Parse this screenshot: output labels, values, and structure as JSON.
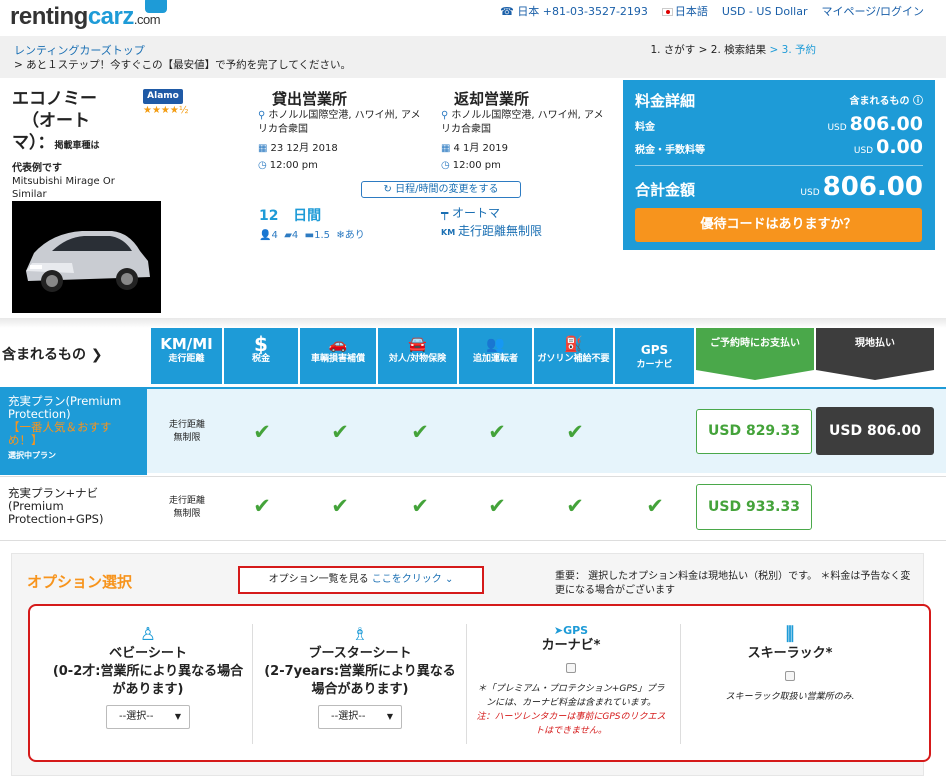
{
  "header": {
    "logo_main": "renting",
    "logo_accent": "carz",
    "logo_suffix": ".com",
    "phone": "日本 +81-03-3527-2193",
    "language": "日本語",
    "currency": "USD - US Dollar",
    "mypage": "マイページ/ログイン"
  },
  "breadcrumb": {
    "top": "レンティングカーズトップ",
    "message": "> あと１ステップ！今すぐこの【最安値】で予約を完了してください。",
    "step1": "1. さがす",
    "step2": "> 2. 検索結果",
    "step3": "> 3. 予約"
  },
  "car": {
    "class_line1": "エコノミー",
    "class_line2": "（オート",
    "class_line3": "マ）：",
    "example_note": "掲載車種は",
    "supplier": "Alamo",
    "stars": "★★★★½",
    "rep_label": "代表例です",
    "model": "Mitsubishi Mirage Or Similar"
  },
  "pickup": {
    "title": "貸出営業所",
    "location": "ホノルル国際空港, ハワイ州, アメリカ合衆国",
    "date": "23 12月 2018",
    "time": "12:00 pm"
  },
  "dropoff": {
    "title": "返却営業所",
    "location": "ホノルル国際空港, ハワイ州, アメリカ合衆国",
    "date": "4 1月 2019",
    "time": "12:00 pm"
  },
  "change_button": "日程/時間の変更をする",
  "rental": {
    "days_num": "12",
    "days_label": "日間",
    "seats": "4",
    "doors": "4",
    "luggage": "1.5",
    "ac": "あり",
    "transmission": "オートマ",
    "mileage": "走行距離無制限"
  },
  "price_panel": {
    "title": "料金詳細",
    "included": "含まれるもの",
    "rate_label": "料金",
    "rate_cur": "USD",
    "rate_value": "806.00",
    "tax_label": "税金・手数料等",
    "tax_cur": "USD",
    "tax_value": "0.00",
    "total_label": "合計金額",
    "total_cur": "USD",
    "total_value": "806.00",
    "promo": "優待コードはありますか？"
  },
  "included_section": {
    "label": "含まれるもの",
    "features": [
      {
        "icon": "KM/MI",
        "label": "走行距離"
      },
      {
        "icon": "$",
        "label": "税金"
      },
      {
        "icon": "🚗",
        "label": "車輌損害補償"
      },
      {
        "icon": "🚘",
        "label": "対人/対物保険"
      },
      {
        "icon": "👥",
        "label": "追加運転者"
      },
      {
        "icon": "⛽",
        "label": "ガソリン補給不要"
      },
      {
        "icon": "GPS",
        "label": "カーナビ"
      }
    ],
    "pay_now": "ご予約時にお支払い",
    "pay_local": "現地払い"
  },
  "plans": [
    {
      "name": "充実プラン(Premium Protection)",
      "highlight": "【一番人気＆おすすめ！】",
      "status": "選択中プラン",
      "mileage1": "走行距離",
      "mileage2": "無制限",
      "price_now": "USD 829.33",
      "price_local": "USD 806.00"
    },
    {
      "name": "充実プラン+ナビ (Premium Protection+GPS)",
      "mileage1": "走行距離",
      "mileage2": "無制限",
      "price_now": "USD 933.33"
    }
  ],
  "options": {
    "title": "オプション選択",
    "list_text": "オプション一覧を見る",
    "list_link": "ここをクリック",
    "notice": "重要： 選択したオプション料金は現地払い（税別）です。 ＊料金は予告なく変更になる場合がございます",
    "items": [
      {
        "name": "ベビーシート",
        "sub": "(0-2才:営業所により異なる場合があります)",
        "select": "--選択--"
      },
      {
        "name": "ブースターシート",
        "sub": "(2-7years:営業所により異なる場合があります)",
        "select": "--選択--"
      },
      {
        "name": "カーナビ*",
        "note": "＊「プレミアム・プロテクション+GPS」プランには、カーナビ料金は含まれています。",
        "red_note": "注：ハーツレンタカーは事前にGPSのリクエストはできません。"
      },
      {
        "name": "スキーラック*",
        "note": "スキーラック取扱い営業所のみ."
      }
    ]
  }
}
